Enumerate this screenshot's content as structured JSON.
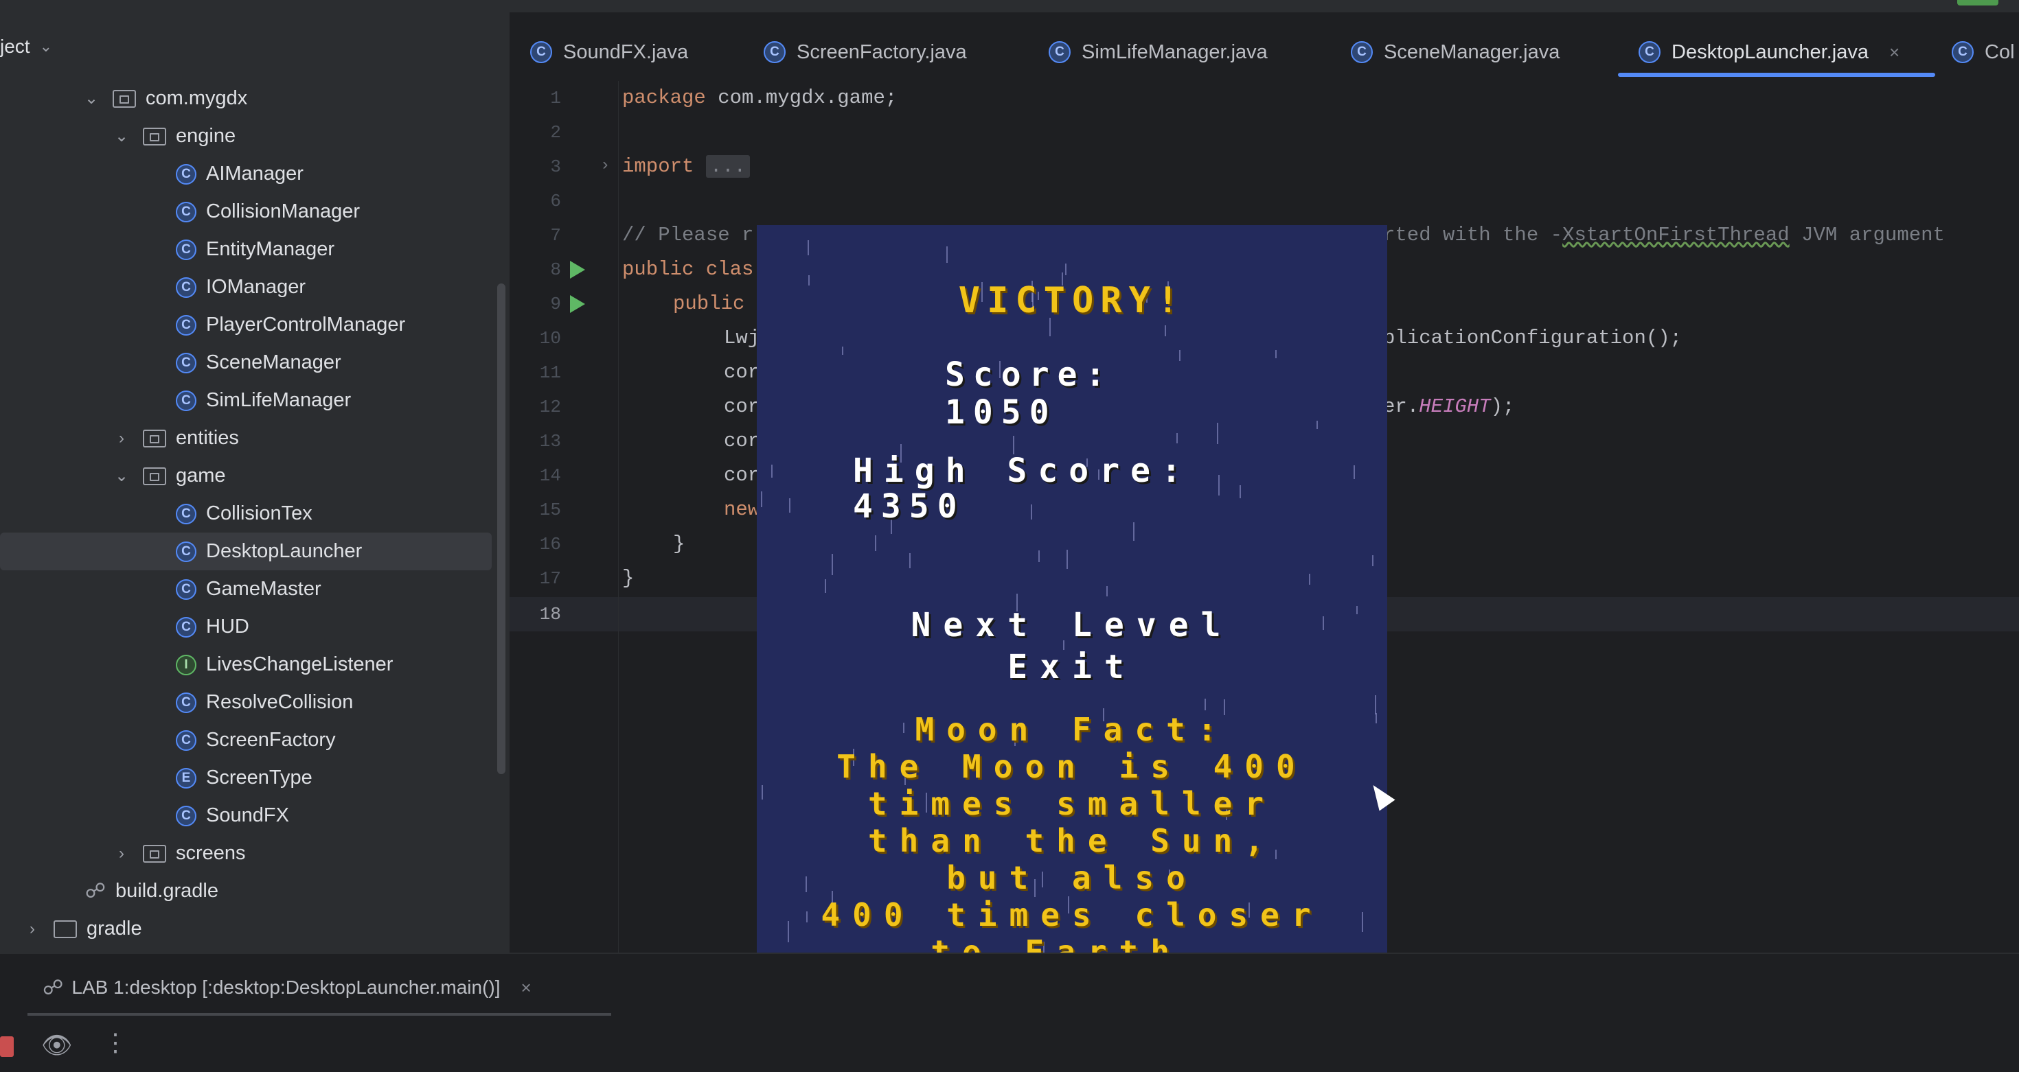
{
  "project": {
    "title": "ject",
    "tree": [
      {
        "label": "com.mygdx",
        "type": "package",
        "arrow": "down",
        "indent": 0
      },
      {
        "label": "engine",
        "type": "package",
        "arrow": "down",
        "indent": 1
      },
      {
        "label": "AIManager",
        "type": "class",
        "indent": 2
      },
      {
        "label": "CollisionManager",
        "type": "class",
        "indent": 2
      },
      {
        "label": "EntityManager",
        "type": "class",
        "indent": 2
      },
      {
        "label": "IOManager",
        "type": "class",
        "indent": 2
      },
      {
        "label": "PlayerControlManager",
        "type": "class",
        "indent": 2
      },
      {
        "label": "SceneManager",
        "type": "class",
        "indent": 2
      },
      {
        "label": "SimLifeManager",
        "type": "class",
        "indent": 2
      },
      {
        "label": "entities",
        "type": "package",
        "arrow": "right",
        "indent": 1
      },
      {
        "label": "game",
        "type": "package",
        "arrow": "down",
        "indent": 1
      },
      {
        "label": "CollisionTex",
        "type": "class",
        "indent": 2
      },
      {
        "label": "DesktopLauncher",
        "type": "class",
        "indent": 2,
        "selected": true
      },
      {
        "label": "GameMaster",
        "type": "class",
        "indent": 2
      },
      {
        "label": "HUD",
        "type": "class",
        "indent": 2
      },
      {
        "label": "LivesChangeListener",
        "type": "interface",
        "indent": 2
      },
      {
        "label": "ResolveCollision",
        "type": "class",
        "indent": 2
      },
      {
        "label": "ScreenFactory",
        "type": "class",
        "indent": 2
      },
      {
        "label": "ScreenType",
        "type": "enum",
        "indent": 2
      },
      {
        "label": "SoundFX",
        "type": "class",
        "indent": 2
      },
      {
        "label": "screens",
        "type": "package",
        "arrow": "right",
        "indent": 1
      },
      {
        "label": "build.gradle",
        "type": "gradle",
        "indent": 0
      },
      {
        "label": "gradle",
        "type": "folder",
        "arrow": "right",
        "indent": -1
      }
    ]
  },
  "tabs": [
    {
      "label": "SoundFX.java"
    },
    {
      "label": "ScreenFactory.java"
    },
    {
      "label": "SimLifeManager.java"
    },
    {
      "label": "SceneManager.java"
    },
    {
      "label": "DesktopLauncher.java",
      "active": true,
      "close": "×"
    },
    {
      "label": "Col"
    }
  ],
  "editor": {
    "line_numbers": [
      "1",
      "2",
      "3",
      "6",
      "7",
      "8",
      "9",
      "10",
      "11",
      "12",
      "13",
      "14",
      "15",
      "16",
      "17",
      "18"
    ],
    "line1_kw": "package",
    "line1_rest": " com.mygdx.game;",
    "line3_kw": "import",
    "line3_dots": "...",
    "line7_comment_a": "// Please r",
    "line7_comment_b": "rted with the -",
    "line7_comment_c": "XstartOnFirstThread",
    "line7_comment_d": " JVM argument",
    "line8_kw": "public clas",
    "line9_kw": "public",
    "line10_a": "Lwj",
    "line10_b": "plicationConfiguration();",
    "line11": "cor",
    "line12_a": "cor",
    "line12_b": "er.",
    "line12_field": "HEIGHT",
    "line12_c": ");",
    "line13": "cor",
    "line14": "cor",
    "line15_kw": "new",
    "line16": "}",
    "line17": "}"
  },
  "game": {
    "victory": "VICTORY!",
    "score_label": "Score:",
    "score_value": "1050",
    "high_score_label": "High Score:",
    "high_score_value": "4350",
    "next_level": "Next Level",
    "exit": "Exit",
    "fact_title": "Moon Fact:",
    "fact_lines": [
      "The Moon is 400",
      "times smaller",
      "than the Sun,",
      "but also",
      "400 times closer",
      "to Earth."
    ]
  },
  "run": {
    "tab_label": "LAB 1:desktop [:desktop:DesktopLauncher.main()]",
    "close": "×"
  },
  "colors": {
    "game_bg": "#232a5c",
    "game_yellow": "#f2c419",
    "accent": "#548af7"
  }
}
